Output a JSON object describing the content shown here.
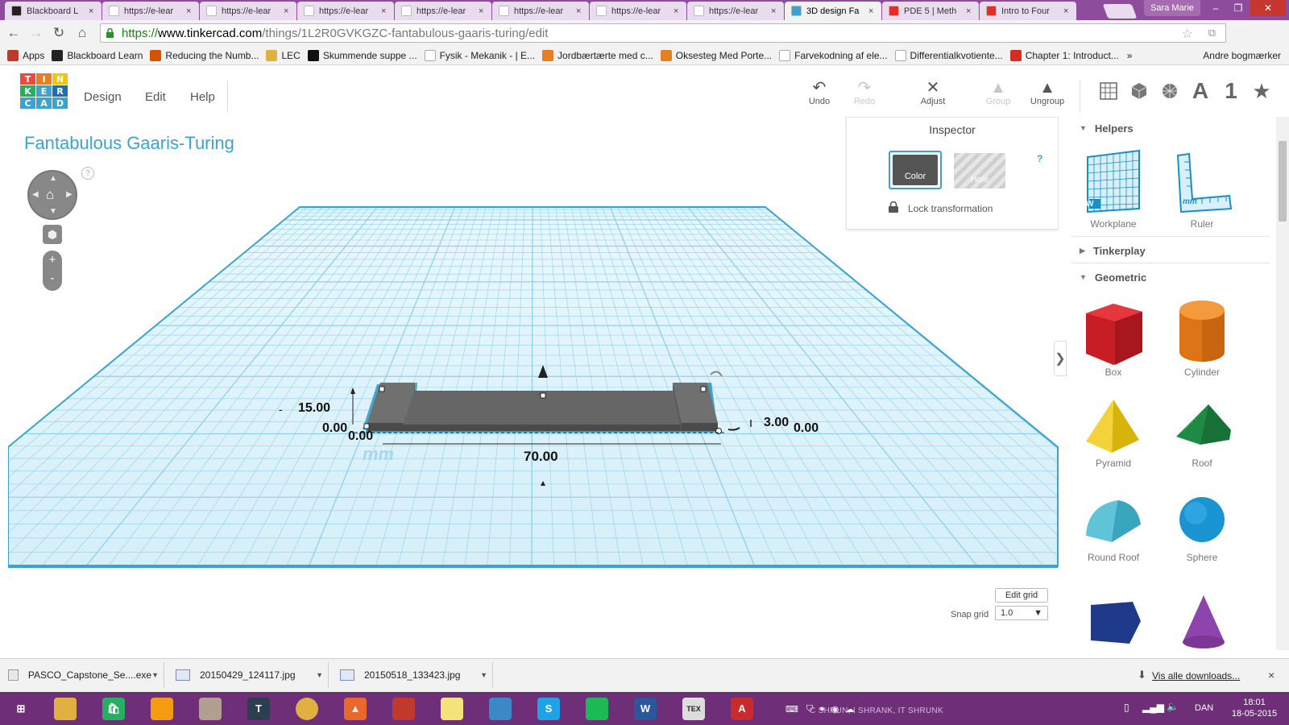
{
  "browser": {
    "tabs": [
      {
        "label": "Blackboard L",
        "favicon": "blackboard-icon",
        "favicon_color": "#222222",
        "active": false
      },
      {
        "label": "https://e-lear",
        "favicon": "page-icon",
        "favicon_color": "#ffffff",
        "active": false
      },
      {
        "label": "https://e-lear",
        "favicon": "page-icon",
        "favicon_color": "#ffffff",
        "active": false
      },
      {
        "label": "https://e-lear",
        "favicon": "page-icon",
        "favicon_color": "#ffffff",
        "active": false
      },
      {
        "label": "https://e-lear",
        "favicon": "page-icon",
        "favicon_color": "#ffffff",
        "active": false
      },
      {
        "label": "https://e-lear",
        "favicon": "page-icon",
        "favicon_color": "#ffffff",
        "active": false
      },
      {
        "label": "https://e-lear",
        "favicon": "page-icon",
        "favicon_color": "#ffffff",
        "active": false
      },
      {
        "label": "https://e-lear",
        "favicon": "page-icon",
        "favicon_color": "#ffffff",
        "active": false
      },
      {
        "label": "3D design Fa",
        "favicon": "tinkercad-icon",
        "favicon_color": "#3ba3d0",
        "active": true
      },
      {
        "label": "PDE 5 | Meth",
        "favicon": "youtube-icon",
        "favicon_color": "#e52d27",
        "active": false
      },
      {
        "label": "Intro to Four",
        "favicon": "youtube-icon",
        "favicon_color": "#e52d27",
        "active": false
      }
    ],
    "profile_name": "Sara Marie",
    "url_secure": "https://",
    "url_host": "www.tinkercad.com",
    "url_path": "/things/1L2R0GVKGZC-fantabulous-gaaris-turing/edit",
    "bookmarks": [
      {
        "label": "Apps",
        "icon": "apps-icon",
        "color": "#c0392b"
      },
      {
        "label": "Blackboard Learn",
        "icon": "blackboard-icon",
        "color": "#222222"
      },
      {
        "label": "Reducing the Numb...",
        "icon": "pen-icon",
        "color": "#d35400"
      },
      {
        "label": "LEC",
        "icon": "folder-icon",
        "color": "#e0b040"
      },
      {
        "label": "Skummende suppe ...",
        "icon": "b-icon",
        "color": "#111111"
      },
      {
        "label": "Fysik - Mekanik - | E...",
        "icon": "page-icon",
        "color": "#ffffff"
      },
      {
        "label": "Jordbærtærte med c...",
        "icon": "recipe-icon",
        "color": "#e67e22"
      },
      {
        "label": "Oksesteg Med Porte...",
        "icon": "recipe-icon",
        "color": "#e67e22"
      },
      {
        "label": "Farvekodning af ele...",
        "icon": "wikipedia-icon",
        "color": "#ffffff"
      },
      {
        "label": "Differentialkvotiente...",
        "icon": "page-icon",
        "color": "#ffffff"
      },
      {
        "label": "Chapter 1: Introduct...",
        "icon": "pdf-icon",
        "color": "#d62d20"
      }
    ],
    "bookmarks_more": "»",
    "other_bookmarks": "Andre bogmærker"
  },
  "tinkercad": {
    "logo_letters": [
      "T",
      "I",
      "N",
      "K",
      "E",
      "R",
      "C",
      "A",
      "D",
      "",
      "",
      ""
    ],
    "logo_colors": [
      "#e84c3d",
      "#e67e22",
      "#f1c40f",
      "#27ae60",
      "#3ba3d0",
      "#1f6fb0",
      "#3ba3d0",
      "#3ba3d0",
      "#3ba3d0",
      "#ffffff",
      "#ffffff",
      "#ffffff"
    ],
    "menu": [
      "Design",
      "Edit",
      "Help"
    ],
    "tools": [
      {
        "label": "Undo",
        "icon": "undo-icon",
        "enabled": true
      },
      {
        "label": "Redo",
        "icon": "redo-icon",
        "enabled": false
      },
      {
        "label": "Adjust",
        "icon": "adjust-icon",
        "enabled": true
      },
      {
        "label": "Group",
        "icon": "group-icon",
        "enabled": false
      },
      {
        "label": "Ungroup",
        "icon": "ungroup-icon",
        "enabled": true
      }
    ],
    "view_buttons": [
      "grid-view-icon",
      "box-view-icon",
      "wireframe-view-icon",
      "letters-view-icon",
      "numbers-view-icon",
      "favorites-star-icon"
    ],
    "view_labels": {
      "letters": "A",
      "numbers": "1"
    },
    "design_title": "Fantabulous Gaaris-Turing",
    "help_mark": "?",
    "inspector": {
      "title": "Inspector",
      "color_label": "Color",
      "hole_label": "Hole",
      "help": "?",
      "lock_label": "Lock transformation",
      "selected_color": "#555555"
    },
    "dimensions": {
      "height": "15.00",
      "left_offset": "0.00",
      "front_offset": "0.00",
      "length": "70.00",
      "right_width": "3.00",
      "right_offset": "0.00",
      "units": "mm"
    },
    "grid": {
      "edit_label": "Edit grid",
      "snap_label": "Snap grid",
      "snap_value": "1.0",
      "grid_color": "#8fd0ec",
      "plane_color": "#d8f0fb"
    },
    "shapes_panel": {
      "sections": [
        {
          "label": "Helpers",
          "expanded": true
        },
        {
          "label": "Tinkerplay",
          "expanded": false
        },
        {
          "label": "Geometric",
          "expanded": true
        }
      ],
      "helpers": [
        {
          "label": "Workplane",
          "icon": "workplane-icon"
        },
        {
          "label": "Ruler",
          "icon": "ruler-icon"
        }
      ],
      "ruler_unit": "mm",
      "workplane_letter": "W",
      "geometric": [
        {
          "label": "Box",
          "icon": "box-icon",
          "color": "#d62027"
        },
        {
          "label": "Cylinder",
          "icon": "cylinder-icon",
          "color": "#e67e22"
        },
        {
          "label": "Pyramid",
          "icon": "pyramid-icon",
          "color": "#f1c40f"
        },
        {
          "label": "Roof",
          "icon": "roof-icon",
          "color": "#27ae60"
        },
        {
          "label": "Round Roof",
          "icon": "round-roof-icon",
          "color": "#5fc4d8"
        },
        {
          "label": "Sphere",
          "icon": "sphere-icon",
          "color": "#1a94d2"
        },
        {
          "label": "",
          "icon": "polygon-icon",
          "color": "#1f3a8a"
        },
        {
          "label": "",
          "icon": "cone-icon",
          "color": "#8e44ad"
        }
      ]
    }
  },
  "downloads": {
    "items": [
      {
        "label": "PASCO_Capstone_Se....exe",
        "icon": "exe-icon"
      },
      {
        "label": "20150429_124117.jpg",
        "icon": "image-file-icon"
      },
      {
        "label": "20150518_133423.jpg",
        "icon": "image-file-icon"
      }
    ],
    "show_all": "Vis alle downloads...",
    "close": "×"
  },
  "taskbar": {
    "apps": [
      {
        "name": "start-button",
        "color": "#6e2f78",
        "glyph": "⊞"
      },
      {
        "name": "file-explorer-icon",
        "color": "#e0b040",
        "glyph": ""
      },
      {
        "name": "store-icon",
        "color": "#27ae60",
        "glyph": "🛍"
      },
      {
        "name": "paint-icon",
        "color": "#f39c12",
        "glyph": ""
      },
      {
        "name": "notepad-icon",
        "color": "#b0a090",
        "glyph": ""
      },
      {
        "name": "texmaker-icon",
        "color": "#2c3e50",
        "glyph": "T"
      },
      {
        "name": "chrome-icon",
        "color": "#e0b040",
        "glyph": ""
      },
      {
        "name": "matlab-icon",
        "color": "#e8692b",
        "glyph": "▲"
      },
      {
        "name": "bug-icon",
        "color": "#c0392b",
        "glyph": ""
      },
      {
        "name": "sticky-notes-icon",
        "color": "#f4e37a",
        "glyph": ""
      },
      {
        "name": "settings-icon",
        "color": "#3a88c5",
        "glyph": ""
      },
      {
        "name": "skype-icon",
        "color": "#1fa3e6",
        "glyph": "S"
      },
      {
        "name": "spotify-icon",
        "color": "#1db954",
        "glyph": ""
      },
      {
        "name": "word-icon",
        "color": "#2b579a",
        "glyph": "W"
      },
      {
        "name": "tex-icon",
        "color": "#dddddd",
        "glyph": "TEX"
      },
      {
        "name": "acrobat-icon",
        "color": "#c82b2b",
        "glyph": "A"
      }
    ],
    "tray_text": "C SHRUN, I SHRANK, IT SHRUNK",
    "language": "DAN",
    "time": "18:01",
    "date": "18-05-2015"
  }
}
